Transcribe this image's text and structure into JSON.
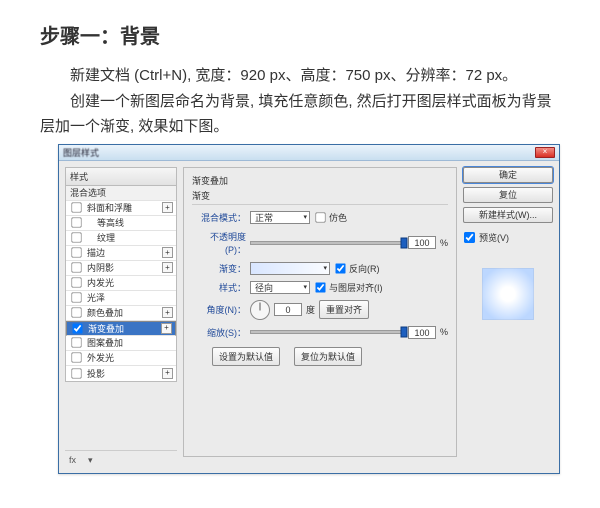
{
  "article": {
    "heading": "步骤一：背景",
    "p1": "新建文档 (Ctrl+N), 宽度：920 px、高度：750 px、分辨率：72 px。",
    "p2": "创建一个新图层命名为背景, 填充任意颜色, 然后打开图层样式面板为背景层加一个渐变, 效果如下图。"
  },
  "dialog": {
    "title": "图层样式",
    "close": "×",
    "left": {
      "header": "样式",
      "items": [
        {
          "label": "混合选项",
          "cat": true
        },
        {
          "label": "斜面和浮雕",
          "chk": true,
          "plus": true
        },
        {
          "label": "等高线",
          "chk": true,
          "indent": true
        },
        {
          "label": "纹理",
          "chk": true,
          "indent": true
        },
        {
          "label": "描边",
          "chk": true,
          "plus": true
        },
        {
          "label": "内阴影",
          "chk": true,
          "plus": true
        },
        {
          "label": "内发光",
          "chk": true
        },
        {
          "label": "光泽",
          "chk": true
        },
        {
          "label": "颜色叠加",
          "chk": true,
          "plus": true
        },
        {
          "label": "渐变叠加",
          "chk": true,
          "plus": true,
          "sel": true
        },
        {
          "label": "图案叠加",
          "chk": true
        },
        {
          "label": "外发光",
          "chk": true
        },
        {
          "label": "投影",
          "chk": true,
          "plus": true
        }
      ],
      "fx": "fx",
      "fx_arrow": "▾"
    },
    "mid": {
      "section": "渐变叠加",
      "sub": "渐变",
      "blend_label": "混合模式：",
      "blend_value": "正常",
      "dither": "仿色",
      "opacity_label": "不透明度(P)：",
      "opacity_value": "100",
      "pct": "%",
      "grad_label": "渐变：",
      "reverse": "反向(R)",
      "style_label": "样式：",
      "style_value": "径向",
      "align_layer": "与图层对齐(I)",
      "angle_label": "角度(N)：",
      "angle_value": "0",
      "angle_unit": "度",
      "reset_align": "重置对齐",
      "scale_label": "缩放(S)：",
      "scale_value": "100",
      "btn_default": "设置为默认值",
      "btn_reset": "复位为默认值"
    },
    "right": {
      "ok": "确定",
      "cancel": "复位",
      "new_style": "新建样式(W)...",
      "preview_chk": "预览(V)"
    }
  }
}
